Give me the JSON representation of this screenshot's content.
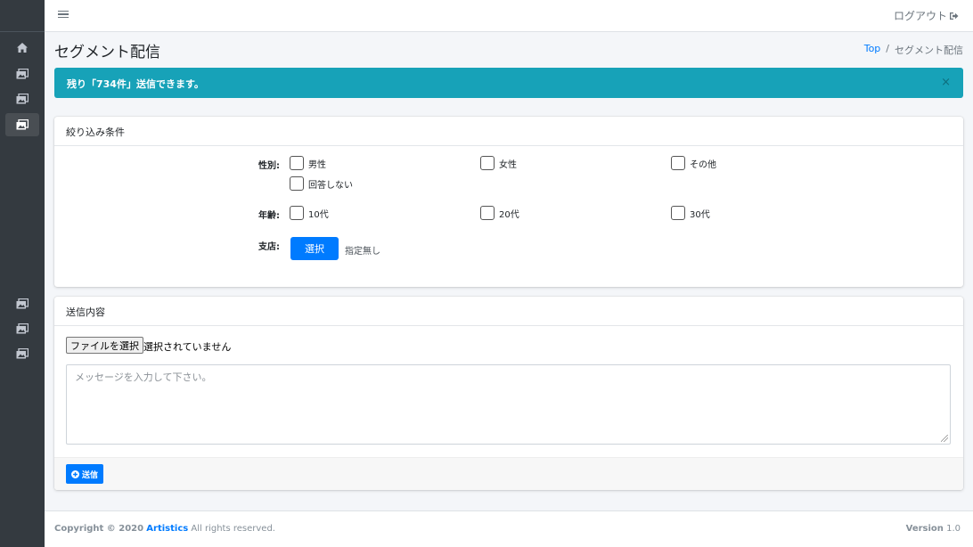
{
  "navbar": {
    "logout_label": "ログアウト"
  },
  "header": {
    "title": "セグメント配信"
  },
  "breadcrumb": {
    "top": "Top",
    "separator": "/",
    "current": "セグメント配信"
  },
  "alert": {
    "message": "残り「734件」送信できます。",
    "close": "×"
  },
  "filter_card": {
    "title": "絞り込み条件",
    "gender_label": "性別:",
    "gender_options": [
      "男性",
      "女性",
      "その他",
      "回答しない"
    ],
    "age_label": "年齢:",
    "age_options": [
      "10代",
      "20代",
      "30代"
    ],
    "branch_label": "支店:",
    "branch_button": "選択",
    "branch_value": "指定無し"
  },
  "content_card": {
    "title": "送信内容",
    "file_button": "ファイルを選択",
    "file_status": "選択されていません",
    "message_placeholder": "メッセージを入力して下さい。",
    "send_button": "送信"
  },
  "footer": {
    "copyright_prefix": "Copyright © 2020",
    "brand": "Artistics",
    "rights": "All rights reserved.",
    "version_label": "Version",
    "version_value": "1.0"
  },
  "colors": {
    "primary": "#007bff",
    "info": "#17a2b8",
    "sidebar": "#343a40"
  },
  "icons": {
    "home": "home-icon",
    "image": "image-icon",
    "logout": "sign-out-icon",
    "send": "plus-circle-icon"
  }
}
